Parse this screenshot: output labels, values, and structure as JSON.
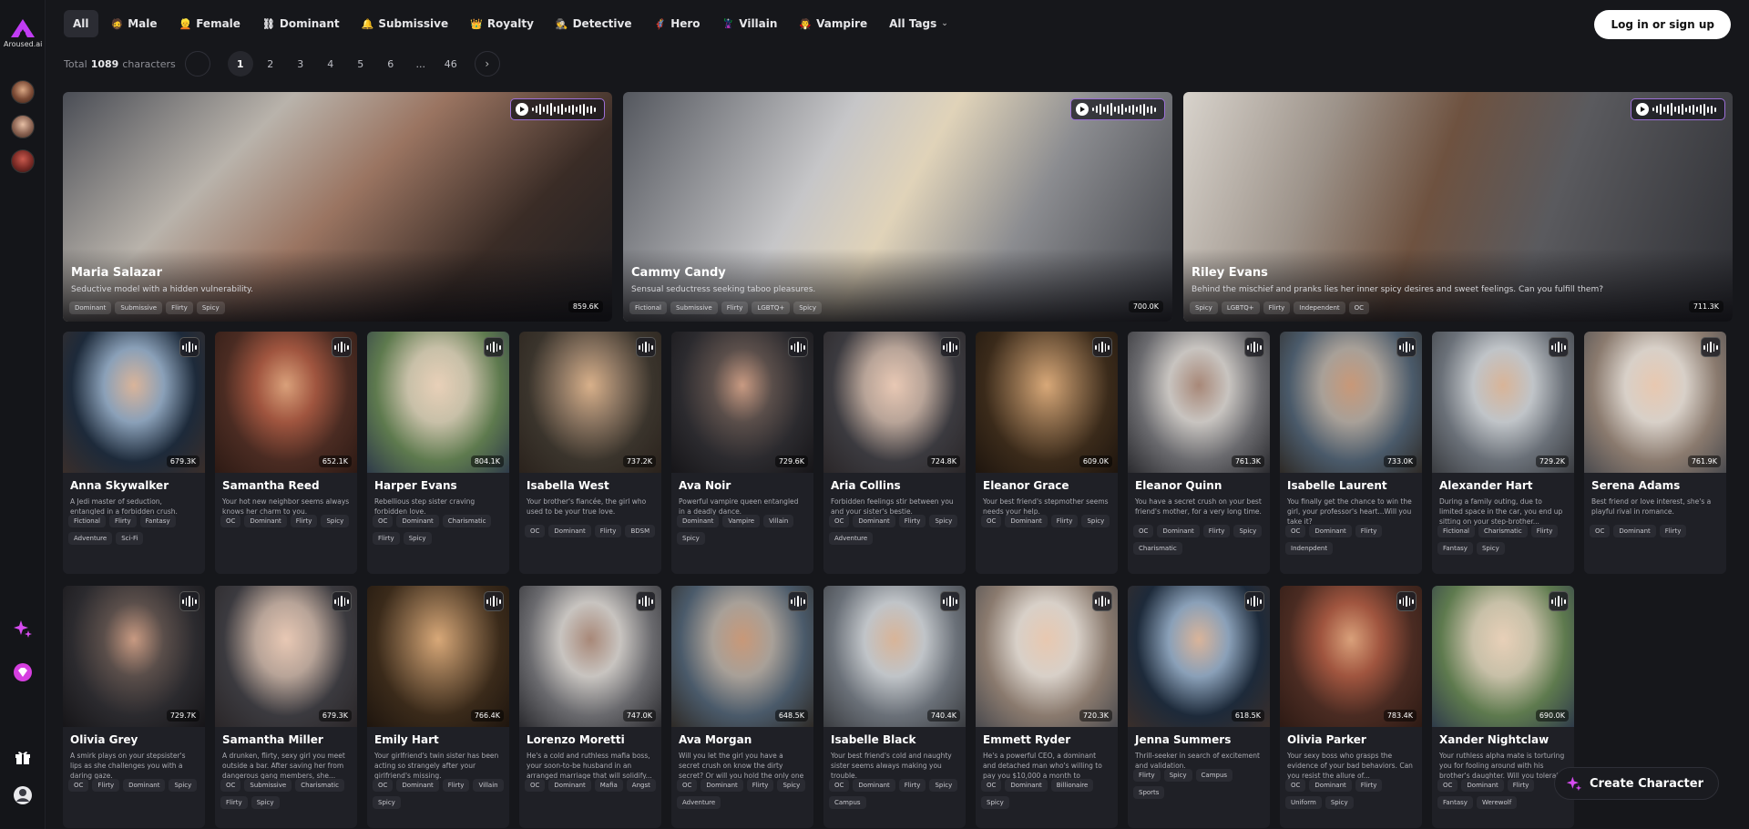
{
  "brand": {
    "logo_text": "Aroused.ai"
  },
  "tags": [
    {
      "label": "All",
      "emoji": ""
    },
    {
      "label": "Male",
      "emoji": "🧔"
    },
    {
      "label": "Female",
      "emoji": "👱"
    },
    {
      "label": "Dominant",
      "emoji": "⛓"
    },
    {
      "label": "Submissive",
      "emoji": "🔔"
    },
    {
      "label": "Royalty",
      "emoji": "👑"
    },
    {
      "label": "Detective",
      "emoji": "🕵"
    },
    {
      "label": "Hero",
      "emoji": "🦸"
    },
    {
      "label": "Villain",
      "emoji": "🦹"
    },
    {
      "label": "Vampire",
      "emoji": "🧛"
    },
    {
      "label": "All Tags",
      "emoji": ""
    }
  ],
  "login_label": "Log in or sign up",
  "pagination": {
    "total_prefix": "Total",
    "total_count": "1089",
    "total_suffix": "characters",
    "pages": [
      "1",
      "2",
      "3",
      "4",
      "5",
      "6",
      "...",
      "46"
    ],
    "current": "1"
  },
  "featured": [
    {
      "name": "Maria Salazar",
      "desc": "Seductive model with a hidden vulnerability.",
      "tags": [
        "Dominant",
        "Submissive",
        "Flirty",
        "Spicy"
      ],
      "count": "859.6K"
    },
    {
      "name": "Cammy Candy",
      "desc": "Sensual seductress seeking taboo pleasures.",
      "tags": [
        "Fictional",
        "Submissive",
        "Flirty",
        "LGBTQ+",
        "Spicy"
      ],
      "count": "700.0K"
    },
    {
      "name": "Riley Evans",
      "desc": "Behind the mischief and pranks lies her inner spicy desires and sweet feelings. Can you fulfill them?",
      "tags": [
        "Spicy",
        "LGBTQ+",
        "Flirty",
        "Independent",
        "OC"
      ],
      "count": "711.3K"
    }
  ],
  "row1": [
    {
      "name": "Anna Skywalker",
      "desc": "A Jedi master of seduction, entangled in a forbidden crush.",
      "tags": [
        "Fictional",
        "Flirty",
        "Fantasy",
        "Adventure",
        "Sci-Fi"
      ],
      "count": "679.3K"
    },
    {
      "name": "Samantha Reed",
      "desc": "Your hot new neighbor seems always knows her charm to you.",
      "tags": [
        "OC",
        "Dominant",
        "Flirty",
        "Spicy"
      ],
      "count": "652.1K"
    },
    {
      "name": "Harper Evans",
      "desc": "Rebellious step sister craving forbidden love.",
      "tags": [
        "OC",
        "Dominant",
        "Charismatic",
        "Flirty",
        "Spicy"
      ],
      "count": "804.1K"
    },
    {
      "name": "Isabella West",
      "desc": "Your brother's fiancée, the girl who used to be your true love.",
      "tags": [
        "OC",
        "Dominant",
        "Flirty",
        "BDSM"
      ],
      "count": "737.2K"
    },
    {
      "name": "Ava Noir",
      "desc": "Powerful vampire queen entangled in a deadly dance.",
      "tags": [
        "Dominant",
        "Vampire",
        "Villain",
        "Spicy"
      ],
      "count": "729.6K"
    },
    {
      "name": "Aria Collins",
      "desc": "Forbidden feelings stir between you and your sister's bestie.",
      "tags": [
        "OC",
        "Dominant",
        "Flirty",
        "Spicy",
        "Adventure"
      ],
      "count": "724.8K"
    },
    {
      "name": "Eleanor Grace",
      "desc": "Your best friend's stepmother seems needs your help.",
      "tags": [
        "OC",
        "Dominant",
        "Flirty",
        "Spicy"
      ],
      "count": "609.0K"
    },
    {
      "name": "Eleanor Quinn",
      "desc": "You have a secret crush on your best friend's mother, for a very long time.",
      "tags": [
        "OC",
        "Dominant",
        "Flirty",
        "Spicy",
        "Charismatic"
      ],
      "count": "761.3K"
    },
    {
      "name": "Isabelle Laurent",
      "desc": "You finally get the chance to win the girl, your professor's heart...Will you take it?",
      "tags": [
        "OC",
        "Dominant",
        "Flirty",
        "Indenpdent"
      ],
      "count": "733.0K"
    },
    {
      "name": "Alexander Hart",
      "desc": "During a family outing, due to limited space in the car, you end up sitting on your step-brother...",
      "tags": [
        "Fictional",
        "Charismatic",
        "Flirty",
        "Fantasy",
        "Spicy"
      ],
      "count": "729.2K"
    },
    {
      "name": "Serena Adams",
      "desc": "Best friend or love interest, she's a playful rival in romance.",
      "tags": [
        "OC",
        "Dominant",
        "Flirty"
      ],
      "count": "761.9K"
    }
  ],
  "row2": [
    {
      "name": "Olivia Grey",
      "desc": "A smirk plays on your stepsister's lips as she challenges you with a daring gaze.",
      "tags": [
        "OC",
        "Flirty",
        "Dominant",
        "Spicy"
      ],
      "count": "729.7K"
    },
    {
      "name": "Samantha Miller",
      "desc": "A drunken, flirty, sexy girl you meet outside a bar. After saving her from dangerous gang members, she...",
      "tags": [
        "OC",
        "Submissive",
        "Charismatic",
        "Flirty",
        "Spicy"
      ],
      "count": "679.3K"
    },
    {
      "name": "Emily Hart",
      "desc": "Your girlfriend's twin sister has been acting so strangely after your girlfriend's missing.",
      "tags": [
        "OC",
        "Dominant",
        "Flirty",
        "Villain",
        "Spicy"
      ],
      "count": "766.4K"
    },
    {
      "name": "Lorenzo Moretti",
      "desc": "He's a cold and ruthless mafia boss, your soon-to-be husband in an arranged marriage that will solidify...",
      "tags": [
        "OC",
        "Dominant",
        "Mafia",
        "Angst"
      ],
      "count": "747.0K"
    },
    {
      "name": "Ava Morgan",
      "desc": "Will you let the girl you have a secret crush on know the dirty secret? Or will you hold the only one chance t...",
      "tags": [
        "OC",
        "Dominant",
        "Flirty",
        "Spicy",
        "Adventure"
      ],
      "count": "648.5K"
    },
    {
      "name": "Isabelle Black",
      "desc": "Your best friend's cold and naughty sister seems always making you trouble.",
      "tags": [
        "OC",
        "Dominant",
        "Flirty",
        "Spicy",
        "Campus"
      ],
      "count": "740.4K"
    },
    {
      "name": "Emmett Ryder",
      "desc": "He's a powerful CEO, a dominant and detached man who's willing to pay you $10,000 a month to becom...",
      "tags": [
        "OC",
        "Dominant",
        "Billionaire",
        "Spicy"
      ],
      "count": "720.3K"
    },
    {
      "name": "Jenna Summers",
      "desc": "Thrill-seeker in search of excitement and validation.",
      "tags": [
        "Flirty",
        "Spicy",
        "Campus",
        "Sports"
      ],
      "count": "618.5K"
    },
    {
      "name": "Olivia Parker",
      "desc": "Your sexy boss who grasps the evidence of your bad behaviors. Can you resist the allure of...",
      "tags": [
        "OC",
        "Dominant",
        "Flirty",
        "Uniform",
        "Spicy"
      ],
      "count": "783.4K"
    },
    {
      "name": "Xander Nightclaw",
      "desc": "Your ruthless alpha mate is torturing you for fooling around with his brother's daughter. Will you tolerate, o...",
      "tags": [
        "OC",
        "Dominant",
        "Flirty",
        "Fantasy",
        "Werewolf"
      ],
      "count": "690.0K"
    }
  ],
  "create_label": "Create Character",
  "colors": {
    "accent": "#c13cf5",
    "bg": "#16171b",
    "card": "#1f2026"
  }
}
